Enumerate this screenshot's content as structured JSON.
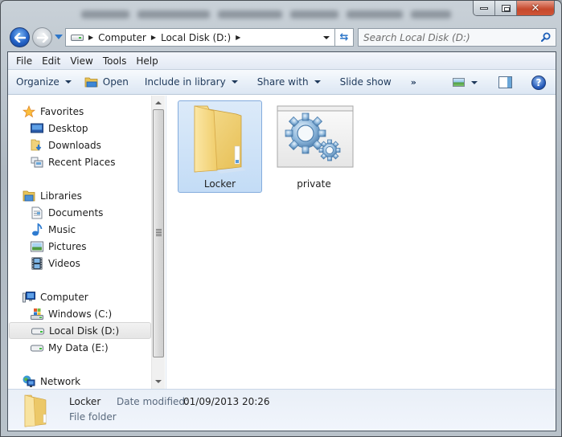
{
  "window": {
    "caption_buttons": {
      "minimize": "minimize",
      "maximize": "maximize",
      "close": "close"
    }
  },
  "navigation": {
    "back": "back",
    "forward": "forward",
    "breadcrumbs": [
      "Computer",
      "Local Disk (D:)"
    ],
    "search_placeholder": "Search Local Disk (D:)"
  },
  "menubar": {
    "items": [
      "File",
      "Edit",
      "View",
      "Tools",
      "Help"
    ]
  },
  "toolbar": {
    "organize": "Organize",
    "open": "Open",
    "include_in_library": "Include in library",
    "share_with": "Share with",
    "slide_show": "Slide show",
    "more": "»"
  },
  "sidebar": {
    "favorites": {
      "label": "Favorites",
      "items": [
        "Desktop",
        "Downloads",
        "Recent Places"
      ]
    },
    "libraries": {
      "label": "Libraries",
      "items": [
        "Documents",
        "Music",
        "Pictures",
        "Videos"
      ]
    },
    "computer": {
      "label": "Computer",
      "items": [
        "Windows (C:)",
        "Local Disk (D:)",
        "My Data (E:)"
      ],
      "selected": "Local Disk (D:)"
    },
    "network": {
      "label": "Network"
    }
  },
  "files": [
    {
      "name": "Locker",
      "type": "folder",
      "selected": true
    },
    {
      "name": "private",
      "type": "settings-file",
      "selected": false
    }
  ],
  "details": {
    "name": "Locker",
    "type": "File folder",
    "date_label": "Date modified:",
    "date_value": "01/09/2013 20:26"
  }
}
